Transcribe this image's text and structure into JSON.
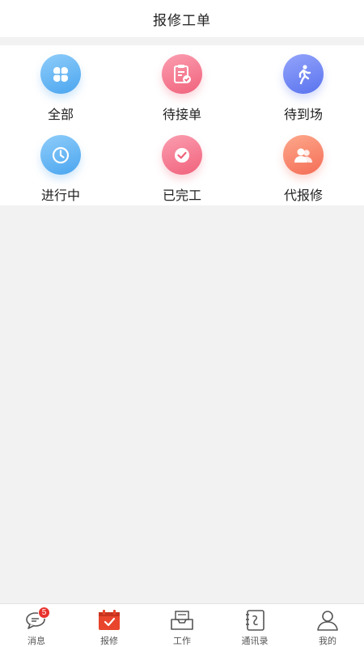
{
  "header": {
    "title": "报修工单"
  },
  "menu": [
    {
      "label": "全部",
      "icon": "clover-icon",
      "color": "#4aa5ef"
    },
    {
      "label": "待接单",
      "icon": "clipboard-check-icon",
      "color": "#f0627c"
    },
    {
      "label": "待到场",
      "icon": "walking-person-icon",
      "color": "#5a73ee"
    },
    {
      "label": "进行中",
      "icon": "clock-icon",
      "color": "#4aa5ef"
    },
    {
      "label": "已完工",
      "icon": "check-circle-icon",
      "color": "#f0627c"
    },
    {
      "label": "代报修",
      "icon": "users-icon",
      "color": "#f46d56"
    }
  ],
  "tabbar": {
    "items": [
      {
        "label": "消息",
        "icon": "chat-bubble-icon",
        "badge": "5"
      },
      {
        "label": "报修",
        "icon": "calendar-check-icon",
        "active": true,
        "color": "#e8452c"
      },
      {
        "label": "工作",
        "icon": "inbox-tray-icon"
      },
      {
        "label": "通讯录",
        "icon": "contacts-book-icon"
      },
      {
        "label": "我的",
        "icon": "person-icon"
      }
    ]
  }
}
